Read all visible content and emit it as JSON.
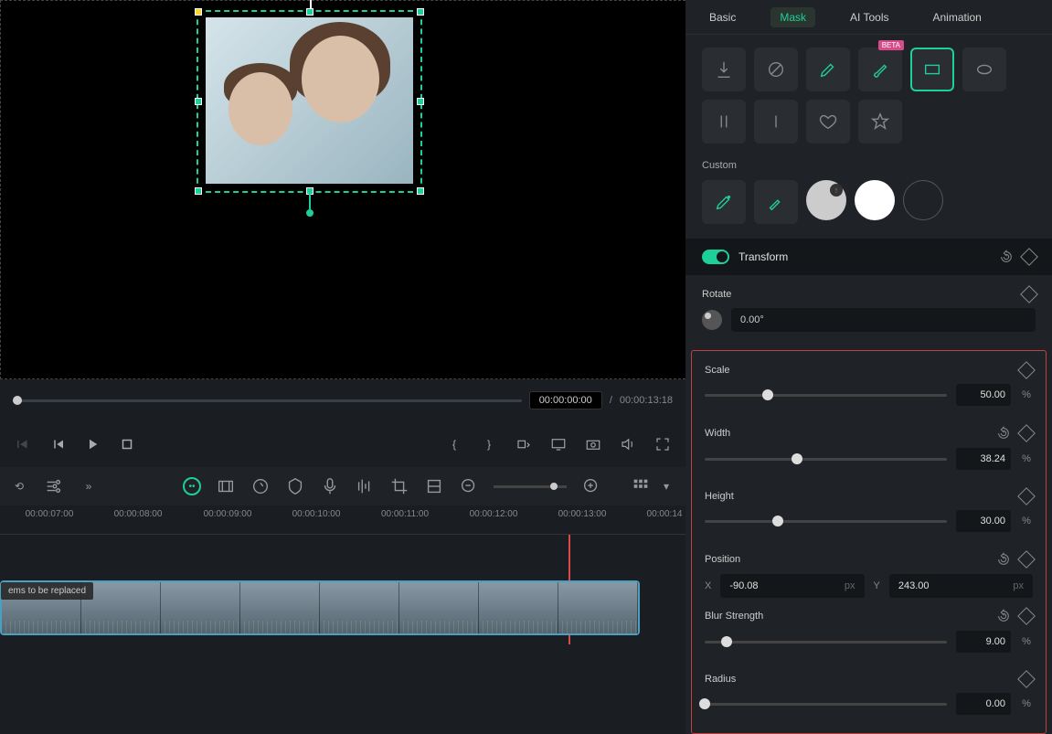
{
  "tabs": {
    "basic": "Basic",
    "mask": "Mask",
    "ai": "AI Tools",
    "anim": "Animation"
  },
  "beta_label": "BETA",
  "custom_label": "Custom",
  "transform": {
    "title": "Transform",
    "rotate": {
      "label": "Rotate",
      "value": "0.00°"
    },
    "scale": {
      "label": "Scale",
      "value": "50.00",
      "unit": "%"
    },
    "width": {
      "label": "Width",
      "value": "38.24",
      "unit": "%"
    },
    "height": {
      "label": "Height",
      "value": "30.00",
      "unit": "%"
    },
    "position": {
      "label": "Position",
      "x_label": "X",
      "x": "-90.08",
      "x_unit": "px",
      "y_label": "Y",
      "y": "243.00",
      "y_unit": "px"
    },
    "blur": {
      "label": "Blur Strength",
      "value": "9.00",
      "unit": "%"
    },
    "radius": {
      "label": "Radius",
      "value": "0.00",
      "unit": "%"
    }
  },
  "time": {
    "current": "00:00:00:00",
    "sep": "/",
    "duration": "00:00:13:18"
  },
  "ruler": [
    "00:00:07:00",
    "00:00:08:00",
    "00:00:09:00",
    "00:00:10:00",
    "00:00:11:00",
    "00:00:12:00",
    "00:00:13:00",
    "00:00:14"
  ],
  "replace_badge": "ems to be replaced",
  "mask_icons": {
    "import": "import-icon",
    "none": "none-icon",
    "pen": "pen-icon",
    "brush": "brush-icon",
    "rect": "rectangle-icon",
    "ellipse": "ellipse-icon",
    "parallel": "parallel-lines-icon",
    "single": "single-line-icon",
    "heart": "heart-icon",
    "star": "star-icon"
  }
}
